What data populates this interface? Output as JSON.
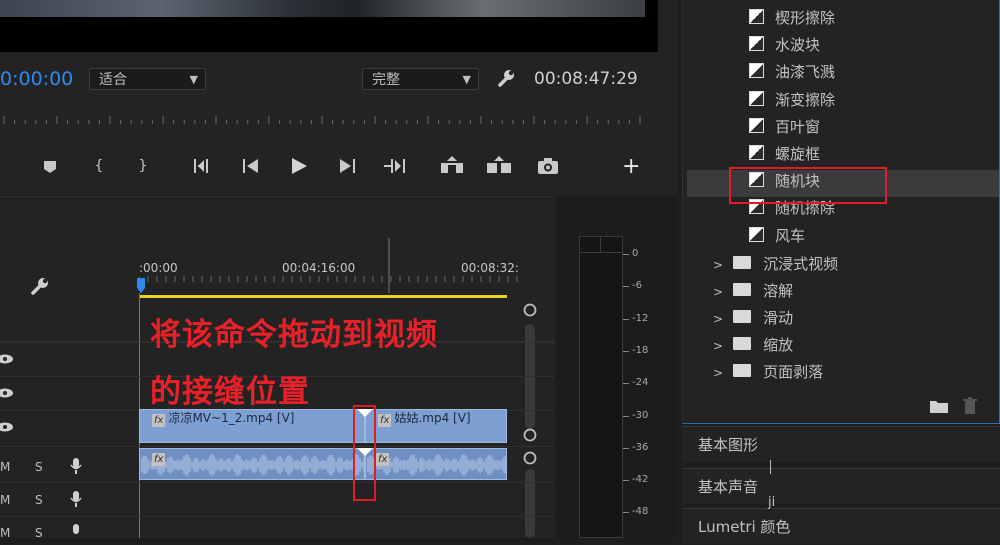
{
  "program_monitor": {
    "playhead_timecode": "0:00:00",
    "fit_dropdown": "适合",
    "quality_dropdown": "完整",
    "duration_timecode": "00:08:47:29",
    "settings_icon": "wrench-icon",
    "transport_icons": [
      "marker-icon",
      "mark-in-icon",
      "mark-out-icon",
      "go-to-in-icon",
      "step-back-icon",
      "play-icon",
      "step-forward-icon",
      "go-to-out-icon",
      "lift-icon",
      "extract-icon",
      "camera-icon",
      "add-button-icon"
    ],
    "add_symbol": "+"
  },
  "timeline": {
    "ruler_labels": [
      ":00:00",
      "00:04:16:00",
      "00:08:32:"
    ],
    "wrench_icon": "wrench-icon",
    "video_clip_1": "凉凉MV~1_2.mp4 [V]",
    "video_clip_2": "姑姑.mp4 [V]",
    "fx_badge": "fx",
    "track_m": "M",
    "track_s": "S",
    "annotation_line1": "将该命令拖动到视频",
    "annotation_line2": "的接缝位置"
  },
  "audio_meter": {
    "scale": [
      "0",
      "-6",
      "-12",
      "-18",
      "-24",
      "-30",
      "-36",
      "-42",
      "-48"
    ]
  },
  "effects_panel": {
    "items": [
      "楔形擦除",
      "水波块",
      "油漆飞溅",
      "渐变擦除",
      "百叶窗",
      "螺旋框",
      "随机块",
      "随机擦除",
      "风车"
    ],
    "folders": [
      "沉浸式视频",
      "溶解",
      "滑动",
      "缩放",
      "页面剥落"
    ],
    "highlighted_item": "随机块",
    "footer_icons": [
      "new-folder-icon",
      "delete-icon"
    ]
  },
  "panels": {
    "essential_graphics": "基本图形",
    "essential_sound": "基本声音",
    "lumetri_color": "Lumetri 颜色"
  },
  "stray_text": [
    "ji"
  ],
  "colors": {
    "accent_blue": "#2d8ceb",
    "clip_blue": "#7e9fd2",
    "annotation_red": "#e8202a",
    "work_area_yellow": "#e8d21d"
  }
}
